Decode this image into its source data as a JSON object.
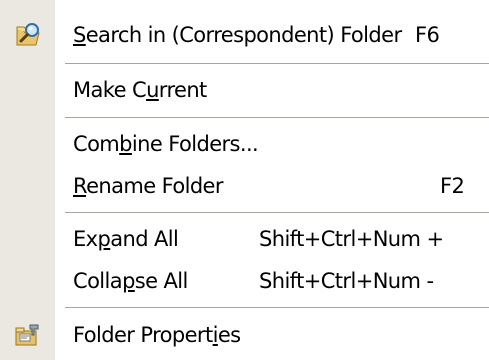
{
  "menu": {
    "items": [
      {
        "id": "search-in-folder",
        "label_pre": "",
        "label_key": "S",
        "label_post": "earch in (Correspondent) Folder",
        "shortcut": "F6",
        "icon": "search-folder-icon"
      },
      {
        "id": "make-current",
        "label_pre": "Make C",
        "label_key": "u",
        "label_post": "rrent",
        "shortcut": ""
      },
      {
        "id": "combine-folders",
        "label_pre": "Com",
        "label_key": "b",
        "label_post": "ine Folders...",
        "shortcut": ""
      },
      {
        "id": "rename-folder",
        "label_pre": "",
        "label_key": "R",
        "label_post": "ename Folder",
        "shortcut": "F2"
      },
      {
        "id": "expand-all",
        "label_pre": "Ex",
        "label_key": "p",
        "label_post": "and All",
        "shortcut": "Shift+Ctrl+Num +"
      },
      {
        "id": "collapse-all",
        "label_pre": "Colla",
        "label_key": "p",
        "label_post": "se All",
        "shortcut": "Shift+Ctrl+Num -"
      },
      {
        "id": "folder-properties",
        "label_pre": "Folder Propert",
        "label_key": "i",
        "label_post": "es",
        "shortcut": "",
        "icon": "folder-properties-icon"
      }
    ]
  },
  "colors": {
    "gutter": "#eae8e0",
    "separator": "#a7a59c",
    "text": "#000000",
    "background": "#ffffff"
  }
}
